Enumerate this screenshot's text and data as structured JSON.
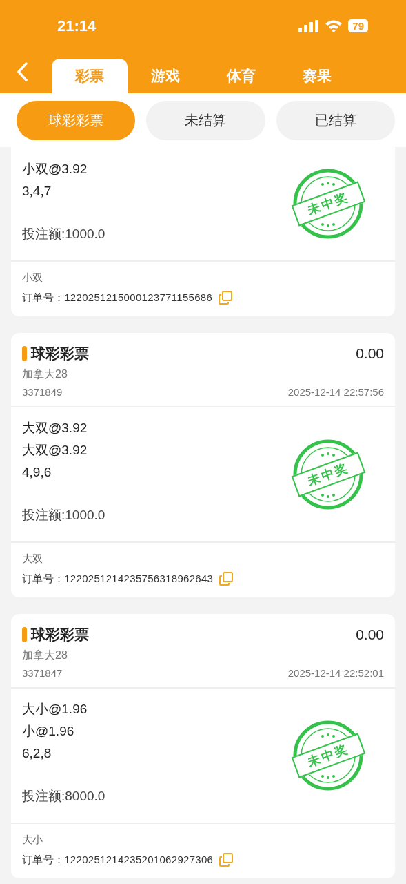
{
  "status_bar": {
    "time": "21:14",
    "battery": "79"
  },
  "tabs": [
    {
      "label": "彩票",
      "selected": true
    },
    {
      "label": "游戏",
      "selected": false
    },
    {
      "label": "体育",
      "selected": false
    },
    {
      "label": "赛果",
      "selected": false
    }
  ],
  "filters": [
    {
      "label": "球彩彩票",
      "selected": true
    },
    {
      "label": "未结算",
      "selected": false
    },
    {
      "label": "已结算",
      "selected": false
    }
  ],
  "orders": [
    {
      "bets": [
        "小双@3.92"
      ],
      "numbers": "3,4,7",
      "stake": "投注额:1000.0",
      "stamp": "未中奖",
      "play": "小双",
      "order_no": "订单号：1220251215000123771155686"
    },
    {
      "header": {
        "title": "球彩彩票",
        "payout": "0.00",
        "game": "加拿大28",
        "issue": "3371849",
        "time": "2025-12-14 22:57:56"
      },
      "bets": [
        "大双@3.92",
        "大双@3.92"
      ],
      "numbers": "4,9,6",
      "stake": "投注额:1000.0",
      "stamp": "未中奖",
      "play": "大双",
      "order_no": "订单号：1220251214235756318962643"
    },
    {
      "header": {
        "title": "球彩彩票",
        "payout": "0.00",
        "game": "加拿大28",
        "issue": "3371847",
        "time": "2025-12-14 22:52:01"
      },
      "bets": [
        "大小@1.96",
        "小@1.96"
      ],
      "numbers": "6,2,8",
      "stake": "投注额:8000.0",
      "stamp": "未中奖",
      "play": "大小",
      "order_no": "订单号：1220251214235201062927306"
    }
  ]
}
